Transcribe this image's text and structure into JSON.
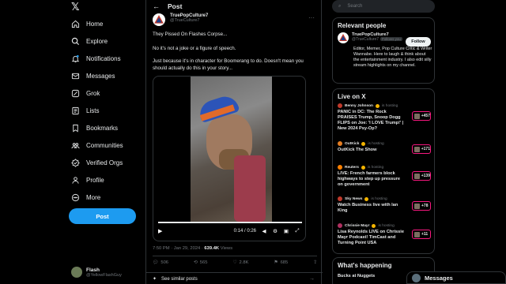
{
  "nav": {
    "items": [
      {
        "label": "Home",
        "icon": "home-icon"
      },
      {
        "label": "Explore",
        "icon": "search-icon"
      },
      {
        "label": "Notifications",
        "icon": "bell-icon"
      },
      {
        "label": "Messages",
        "icon": "envelope-icon"
      },
      {
        "label": "Grok",
        "icon": "grok-icon"
      },
      {
        "label": "Lists",
        "icon": "list-icon"
      },
      {
        "label": "Bookmarks",
        "icon": "bookmark-icon"
      },
      {
        "label": "Communities",
        "icon": "communities-icon"
      },
      {
        "label": "Verified Orgs",
        "icon": "verified-icon"
      },
      {
        "label": "Profile",
        "icon": "person-icon"
      },
      {
        "label": "More",
        "icon": "more-circle-icon"
      }
    ],
    "post_label": "Post",
    "me_name": "Flash",
    "me_handle": "@YellowFlashGuy"
  },
  "header": {
    "title": "Post"
  },
  "tweet": {
    "author_name": "TruePopCulture7",
    "author_handle": "@TrueCulture7",
    "lines": [
      "They Pissed On Flashes Corpse...",
      "No it's not a joke or a figure of speech.",
      "Just because it's in character for Boomerang to do. Doesn't mean you should actually do this in your story..."
    ],
    "video_time": "0:14 / 0:26",
    "timestamp": "7:50 PM · Jan 29, 2024 · ",
    "views_count": "639.4K",
    "views_label": " Views",
    "replies": "506",
    "reposts": "565",
    "likes": "2.8K",
    "bookmarks": "685",
    "similar": "See similar posts"
  },
  "search": {
    "placeholder": "Search"
  },
  "relevant": {
    "title": "Relevant people",
    "name": "TruePopCulture7",
    "handle": "@TrueCulture7",
    "follows_you": "Follows you",
    "follow_label": "Follow",
    "bio": "Editor, Memer, Pop Culture Critic & Writer Wannabe. Here to laugh & think about the entertainment industry. I also edit silly stream highlights on my channel."
  },
  "live": {
    "title": "Live on X",
    "items": [
      {
        "host": "Benny Johnson",
        "status": "is hosting",
        "title": "PANIC in DC: The Rock PRAISES Trump, Snoop Dogg FLIPS on Joe: 'I LOVE Trump!' | New 2024 Psy-Op?",
        "count": "+457",
        "color": "#c0392b"
      },
      {
        "host": "OutKick",
        "status": "is hosting",
        "title": "OutKick The Show",
        "count": "+171",
        "color": "#e67e22"
      },
      {
        "host": "Reuters",
        "status": "is hosting",
        "title": "LIVE: French farmers block highways to step up pressure on government",
        "count": "+139",
        "color": "#ff8000"
      },
      {
        "host": "Sky News",
        "status": "is hosting",
        "title": "Watch Business live with Ian King",
        "count": "+78",
        "color": "#c0392b"
      },
      {
        "host": "Chrissie Mayr",
        "status": "is hosting",
        "title": "Lisa Reynolds LIVE on Chrissie Mayr Podcast! TimCast and Turning Point USA",
        "count": "+11",
        "color": "#b03060"
      }
    ]
  },
  "happening": {
    "title": "What's happening",
    "first_item": "Bucks at Nuggets"
  },
  "messages_dock": {
    "label": "Messages"
  }
}
